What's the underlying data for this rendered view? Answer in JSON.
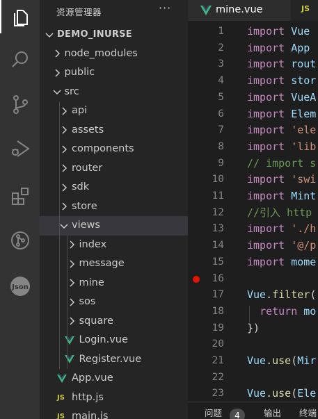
{
  "explorer": {
    "title": "资源管理器",
    "more": "···",
    "tree": [
      {
        "label": "DEMO_INURSE",
        "type": "root",
        "chevron": "down"
      },
      {
        "label": "node_modules",
        "type": "folder",
        "chevron": "right"
      },
      {
        "label": "public",
        "type": "folder",
        "chevron": "right"
      },
      {
        "label": "src",
        "type": "folder",
        "chevron": "down"
      },
      {
        "label": "api",
        "type": "folder",
        "chevron": "right"
      },
      {
        "label": "assets",
        "type": "folder",
        "chevron": "right"
      },
      {
        "label": "components",
        "type": "folder",
        "chevron": "right"
      },
      {
        "label": "router",
        "type": "folder",
        "chevron": "right"
      },
      {
        "label": "sdk",
        "type": "folder",
        "chevron": "right"
      },
      {
        "label": "store",
        "type": "folder",
        "chevron": "right"
      },
      {
        "label": "views",
        "type": "folder",
        "chevron": "down",
        "selected": true
      },
      {
        "label": "index",
        "type": "folder",
        "chevron": "right"
      },
      {
        "label": "message",
        "type": "folder",
        "chevron": "right"
      },
      {
        "label": "mine",
        "type": "folder",
        "chevron": "right"
      },
      {
        "label": "sos",
        "type": "folder",
        "chevron": "right"
      },
      {
        "label": "square",
        "type": "folder",
        "chevron": "right"
      },
      {
        "label": "Login.vue",
        "type": "vue"
      },
      {
        "label": "Register.vue",
        "type": "vue"
      },
      {
        "label": "App.vue",
        "type": "vue"
      },
      {
        "label": "http.js",
        "type": "js",
        "icon_text": "JS"
      },
      {
        "label": "main.js",
        "type": "js",
        "icon_text": "JS"
      }
    ]
  },
  "tabs": {
    "active_label": "mine.vue",
    "second_icon_text": "JS"
  },
  "activity_icons": [
    "files-icon",
    "search-icon",
    "source-control-icon",
    "run-debug-icon",
    "extensions-icon",
    "git-graph-icon",
    "json-icon"
  ],
  "json_icon_text": "Json",
  "code_lines": [
    {
      "n": "1",
      "tokens": [
        {
          "t": "import",
          "c": "kw"
        },
        {
          "t": " Vue",
          "c": "id"
        }
      ]
    },
    {
      "n": "2",
      "tokens": [
        {
          "t": "import",
          "c": "kw"
        },
        {
          "t": " App",
          "c": "id"
        }
      ]
    },
    {
      "n": "3",
      "tokens": [
        {
          "t": "import",
          "c": "kw"
        },
        {
          "t": " rout",
          "c": "id"
        }
      ]
    },
    {
      "n": "4",
      "tokens": [
        {
          "t": "import",
          "c": "kw"
        },
        {
          "t": " stor",
          "c": "id"
        }
      ]
    },
    {
      "n": "5",
      "tokens": [
        {
          "t": "import",
          "c": "kw"
        },
        {
          "t": " VueA",
          "c": "id"
        }
      ]
    },
    {
      "n": "6",
      "tokens": [
        {
          "t": "import",
          "c": "kw"
        },
        {
          "t": " Elem",
          "c": "id"
        }
      ]
    },
    {
      "n": "7",
      "tokens": [
        {
          "t": "import",
          "c": "kw"
        },
        {
          "t": " 'ele",
          "c": "str"
        }
      ]
    },
    {
      "n": "8",
      "tokens": [
        {
          "t": "import",
          "c": "kw"
        },
        {
          "t": " 'lib",
          "c": "str"
        }
      ]
    },
    {
      "n": "9",
      "tokens": [
        {
          "t": "// import s",
          "c": "cm"
        }
      ]
    },
    {
      "n": "10",
      "tokens": [
        {
          "t": "import",
          "c": "kw"
        },
        {
          "t": " 'swi",
          "c": "str"
        }
      ]
    },
    {
      "n": "11",
      "tokens": [
        {
          "t": "import",
          "c": "kw"
        },
        {
          "t": " Mint",
          "c": "id"
        }
      ]
    },
    {
      "n": "12",
      "tokens": [
        {
          "t": "//引入 http",
          "c": "cm"
        }
      ]
    },
    {
      "n": "13",
      "tokens": [
        {
          "t": "import",
          "c": "kw"
        },
        {
          "t": " './h",
          "c": "str"
        }
      ]
    },
    {
      "n": "14",
      "tokens": [
        {
          "t": "import",
          "c": "kw"
        },
        {
          "t": " '@/p",
          "c": "str"
        }
      ]
    },
    {
      "n": "15",
      "tokens": [
        {
          "t": "import",
          "c": "kw"
        },
        {
          "t": " mome",
          "c": "id"
        }
      ]
    },
    {
      "n": "16",
      "tokens": []
    },
    {
      "n": "17",
      "tokens": [
        {
          "t": "Vue",
          "c": "id"
        },
        {
          "t": ".",
          "c": "pl"
        },
        {
          "t": "filter",
          "c": "fn"
        },
        {
          "t": "(",
          "c": "pl"
        }
      ]
    },
    {
      "n": "18",
      "tokens": [
        {
          "t": "  ",
          "c": "pl"
        },
        {
          "t": "return",
          "c": "kw"
        },
        {
          "t": " mo",
          "c": "id"
        }
      ]
    },
    {
      "n": "19",
      "tokens": [
        {
          "t": "})",
          "c": "pl"
        }
      ]
    },
    {
      "n": "20",
      "tokens": []
    },
    {
      "n": "21",
      "tokens": [
        {
          "t": "Vue",
          "c": "id"
        },
        {
          "t": ".",
          "c": "pl"
        },
        {
          "t": "use",
          "c": "fn"
        },
        {
          "t": "(",
          "c": "pl"
        },
        {
          "t": "Mir",
          "c": "id"
        }
      ]
    },
    {
      "n": "22",
      "tokens": []
    },
    {
      "n": "23",
      "tokens": [
        {
          "t": "Vue",
          "c": "id"
        },
        {
          "t": ".",
          "c": "pl"
        },
        {
          "t": "use",
          "c": "fn"
        },
        {
          "t": "(",
          "c": "pl"
        },
        {
          "t": "Ele",
          "c": "id"
        }
      ]
    }
  ],
  "breakpoint_line": "16",
  "panel": {
    "problems_label": "问题",
    "problems_count": "4",
    "output_label": "输出",
    "terminal_label": "终端"
  },
  "colors": {
    "activity_bar": "#333333",
    "sidebar": "#252526",
    "editor": "#1e1e1e",
    "selected_row": "#37373d",
    "vue_green": "#41b883",
    "js_yellow": "#cbcb41",
    "breakpoint_red": "#e51400"
  }
}
